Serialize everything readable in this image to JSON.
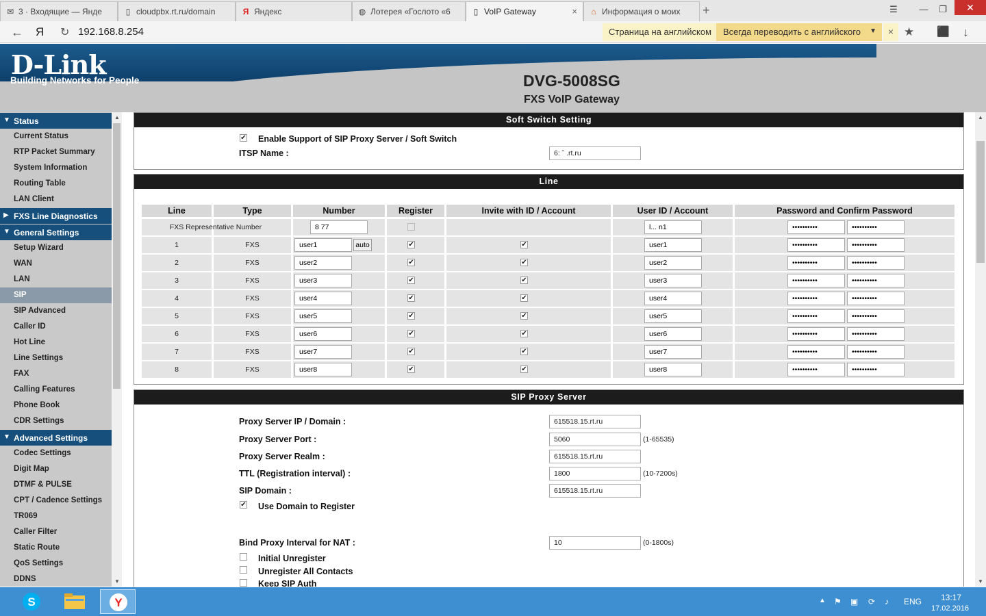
{
  "browser": {
    "tabs": [
      {
        "label": "3 · Входящие — Янде",
        "icon": "mail-icon"
      },
      {
        "label": "cloudpbx.rt.ru/domain",
        "icon": "page-icon"
      },
      {
        "label": "Яндекс",
        "icon": "yandex-icon"
      },
      {
        "label": "Лотерея «Гослото «6",
        "icon": "globe-icon"
      },
      {
        "label": "VoIP Gateway",
        "icon": "page-icon",
        "close": "×"
      },
      {
        "label": "Информация о моих",
        "icon": "rt-icon"
      }
    ],
    "new_tab": "+",
    "url": "192.168.8.254",
    "back_glyph": "←",
    "yandex_glyph": "Я",
    "translate_notice": "Страница на английском",
    "translate_always": "Всегда переводить с английского",
    "translate_close": "×",
    "star_glyph": "★",
    "download_glyph": "↓"
  },
  "header": {
    "logo": "D-Link",
    "tagline": "Building Networks for People",
    "model": "DVG-5008SG",
    "subtitle": "FXS VoIP Gateway"
  },
  "sidebar": {
    "sections": [
      {
        "label": "Status",
        "expanded": true,
        "items": [
          "Current Status",
          "RTP Packet Summary",
          "System Information",
          "Routing Table",
          "LAN Client"
        ]
      },
      {
        "label": "FXS Line Diagnostics",
        "expanded": false,
        "items": []
      },
      {
        "label": "General Settings",
        "expanded": true,
        "items": [
          "Setup Wizard",
          "WAN",
          "LAN",
          "SIP",
          "SIP Advanced",
          "Caller ID",
          "Hot Line",
          "Line Settings",
          "FAX",
          "Calling Features",
          "Phone Book",
          "CDR Settings"
        ]
      },
      {
        "label": "Advanced Settings",
        "expanded": true,
        "items": [
          "Codec Settings",
          "Digit Map",
          "DTMF & PULSE",
          "CPT / Cadence Settings",
          "TR069",
          "Caller Filter",
          "Static Route",
          "QoS Settings",
          "DDNS"
        ]
      }
    ],
    "active_item": "SIP"
  },
  "soft_switch": {
    "title": "Soft Switch Setting",
    "enable_label": "Enable Support of SIP Proxy Server / Soft Switch",
    "enable_checked": true,
    "itsp_label": "ITSP Name :",
    "itsp_value": "6:  ˆ   .rt.ru"
  },
  "line": {
    "title": "Line",
    "columns": [
      "Line",
      "Type",
      "Number",
      "Register",
      "Invite with ID / Account",
      "User ID / Account",
      "Password and Confirm Password"
    ],
    "rep_row": {
      "label": "FXS Representative Number",
      "number": "8        77",
      "user_id": "l...          n1",
      "password": "••••••••••",
      "confirm": "••••••••••"
    },
    "auto_label": "auto",
    "rows": [
      {
        "line": "1",
        "type": "FXS",
        "number": "user1",
        "user_id": "user1",
        "password": "••••••••••",
        "confirm": "••••••••••"
      },
      {
        "line": "2",
        "type": "FXS",
        "number": "user2",
        "user_id": "user2",
        "password": "••••••••••",
        "confirm": "••••••••••"
      },
      {
        "line": "3",
        "type": "FXS",
        "number": "user3",
        "user_id": "user3",
        "password": "••••••••••",
        "confirm": "••••••••••"
      },
      {
        "line": "4",
        "type": "FXS",
        "number": "user4",
        "user_id": "user4",
        "password": "••••••••••",
        "confirm": "••••••••••"
      },
      {
        "line": "5",
        "type": "FXS",
        "number": "user5",
        "user_id": "user5",
        "password": "••••••••••",
        "confirm": "••••••••••"
      },
      {
        "line": "6",
        "type": "FXS",
        "number": "user6",
        "user_id": "user6",
        "password": "••••••••••",
        "confirm": "••••••••••"
      },
      {
        "line": "7",
        "type": "FXS",
        "number": "user7",
        "user_id": "user7",
        "password": "••••••••••",
        "confirm": "••••••••••"
      },
      {
        "line": "8",
        "type": "FXS",
        "number": "user8",
        "user_id": "user8",
        "password": "••••••••••",
        "confirm": "••••••••••"
      }
    ]
  },
  "proxy": {
    "title": "SIP Proxy Server",
    "ip_label": "Proxy Server IP / Domain :",
    "ip_value": "615518.15.rt.ru",
    "port_label": "Proxy Server Port :",
    "port_value": "5060",
    "port_hint": "(1-65535)",
    "realm_label": "Proxy Server Realm :",
    "realm_value": "615518.15.rt.ru",
    "ttl_label": "TTL (Registration interval) :",
    "ttl_value": "1800",
    "ttl_hint": "(10-7200s)",
    "domain_label": "SIP Domain :",
    "domain_value": "615518.15.rt.ru",
    "use_domain_label": "Use Domain to Register",
    "use_domain_checked": true,
    "bind_label": "Bind Proxy Interval for NAT :",
    "bind_value": "10",
    "bind_hint": "(0-1800s)",
    "initial_unreg": "Initial Unregister",
    "unreg_all": "Unregister All Contacts",
    "keep_auth": "Keep SIP Auth"
  },
  "taskbar": {
    "lang": "ENG",
    "time": "13:17",
    "date": "17.02.2016"
  },
  "colors": {
    "dlink_blue": "#164f7c",
    "panel_header": "#1c1c1c",
    "taskbar": "#3e8fd1"
  }
}
